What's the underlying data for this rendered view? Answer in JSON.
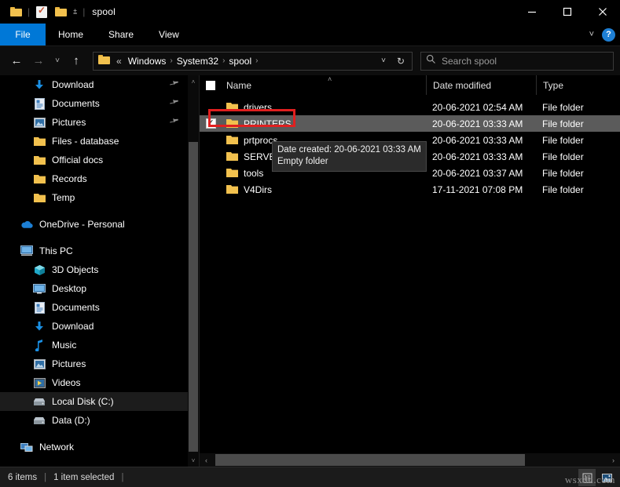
{
  "window": {
    "title": "spool",
    "quick_access": [
      "folder-icon",
      "properties-icon",
      "new-folder-icon",
      "customize-caret-icon"
    ],
    "minimize_label": "Minimize",
    "maximize_label": "Maximize",
    "close_label": "Close"
  },
  "ribbon": {
    "tabs": [
      {
        "label": "File",
        "active": true
      },
      {
        "label": "Home",
        "active": false
      },
      {
        "label": "Share",
        "active": false
      },
      {
        "label": "View",
        "active": false
      }
    ],
    "expand_label": "˅",
    "help_label": "?"
  },
  "nav": {
    "back_label": "←",
    "forward_label": "→",
    "recent_label": "˅",
    "up_label": "↑",
    "breadcrumb_lead": "«",
    "breadcrumbs": [
      "Windows",
      "System32",
      "spool"
    ],
    "separator": "›",
    "dropdown_label": "˅",
    "refresh_label": "↻"
  },
  "search": {
    "icon": "search-icon",
    "placeholder": "Search spool",
    "value": ""
  },
  "sidebar": {
    "items": [
      {
        "label": "Download",
        "icon": "download-arrow-icon",
        "indent": 1,
        "pinned": true,
        "selected": false
      },
      {
        "label": "Documents",
        "icon": "document-icon",
        "indent": 1,
        "pinned": true,
        "selected": false
      },
      {
        "label": "Pictures",
        "icon": "pictures-icon",
        "indent": 1,
        "pinned": true,
        "selected": false
      },
      {
        "label": "Files - database",
        "icon": "folder-icon",
        "indent": 1,
        "pinned": false,
        "selected": false
      },
      {
        "label": "Official docs",
        "icon": "folder-icon",
        "indent": 1,
        "pinned": false,
        "selected": false
      },
      {
        "label": "Records",
        "icon": "folder-icon",
        "indent": 1,
        "pinned": false,
        "selected": false
      },
      {
        "label": "Temp",
        "icon": "folder-icon",
        "indent": 1,
        "pinned": false,
        "selected": false
      },
      {
        "label": "OneDrive - Personal",
        "icon": "onedrive-cloud-icon",
        "indent": 0,
        "pinned": false,
        "selected": false,
        "gap_before": true
      },
      {
        "label": "This PC",
        "icon": "this-pc-icon",
        "indent": 0,
        "pinned": false,
        "selected": false,
        "gap_before": true
      },
      {
        "label": "3D Objects",
        "icon": "3d-objects-icon",
        "indent": 1,
        "pinned": false,
        "selected": false
      },
      {
        "label": "Desktop",
        "icon": "desktop-icon",
        "indent": 1,
        "pinned": false,
        "selected": false
      },
      {
        "label": "Documents",
        "icon": "document-icon",
        "indent": 1,
        "pinned": false,
        "selected": false
      },
      {
        "label": "Download",
        "icon": "download-arrow-icon",
        "indent": 1,
        "pinned": false,
        "selected": false
      },
      {
        "label": "Music",
        "icon": "music-note-icon",
        "indent": 1,
        "pinned": false,
        "selected": false
      },
      {
        "label": "Pictures",
        "icon": "pictures-icon",
        "indent": 1,
        "pinned": false,
        "selected": false
      },
      {
        "label": "Videos",
        "icon": "videos-icon",
        "indent": 1,
        "pinned": false,
        "selected": false
      },
      {
        "label": "Local Disk (C:)",
        "icon": "hard-disk-icon",
        "indent": 1,
        "pinned": false,
        "selected": true
      },
      {
        "label": "Data (D:)",
        "icon": "hard-disk-icon",
        "indent": 1,
        "pinned": false,
        "selected": false
      },
      {
        "label": "Network",
        "icon": "network-icon",
        "indent": 0,
        "pinned": false,
        "selected": false,
        "gap_before": true
      }
    ],
    "scroll_up_label": "˄",
    "scroll_down_label": "˅"
  },
  "filelist": {
    "columns": [
      {
        "label": "Name",
        "sorted": "asc"
      },
      {
        "label": "Date modified",
        "sorted": ""
      },
      {
        "label": "Type",
        "sorted": ""
      }
    ],
    "sort_caret": "˄",
    "rows": [
      {
        "name": "drivers",
        "date": "20-06-2021 02:54 AM",
        "type": "File folder",
        "selected": false,
        "checked": false
      },
      {
        "name": "PRINTERS",
        "date": "20-06-2021 03:33 AM",
        "type": "File folder",
        "selected": true,
        "checked": true
      },
      {
        "name": "prtprocs",
        "date": "20-06-2021 03:33 AM",
        "type": "File folder",
        "selected": false,
        "checked": false
      },
      {
        "name": "SERVERS",
        "date": "20-06-2021 03:33 AM",
        "type": "File folder",
        "selected": false,
        "checked": false
      },
      {
        "name": "tools",
        "date": "20-06-2021 03:37 AM",
        "type": "File folder",
        "selected": false,
        "checked": false
      },
      {
        "name": "V4Dirs",
        "date": "17-11-2021 07:08 PM",
        "type": "File folder",
        "selected": false,
        "checked": false
      }
    ],
    "scroll_left_label": "‹",
    "scroll_right_label": "›"
  },
  "tooltip": {
    "line1": "Date created: 20-06-2021 03:33 AM",
    "line2": "Empty folder"
  },
  "status": {
    "item_count": "6 items",
    "selection": "1 item selected",
    "sep": "|",
    "view_details_icon": "details-view-icon",
    "view_thumbnails_icon": "large-icons-view-icon"
  },
  "watermark": {
    "text": "wsxdn.com"
  },
  "colors": {
    "accent": "#0078d7",
    "selection_row": "#5b5b5b",
    "annotation_red": "#e01f1f",
    "folder_yellow": "#f2c14e",
    "background": "#000000"
  }
}
